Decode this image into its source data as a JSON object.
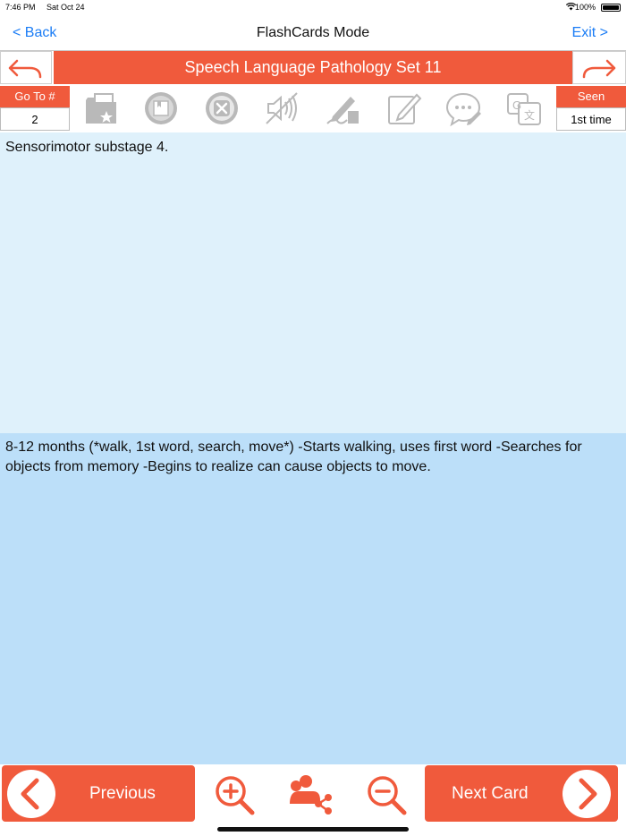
{
  "status_bar": {
    "time": "7:46 PM",
    "date": "Sat Oct 24",
    "battery": "100%"
  },
  "nav": {
    "back_label": "< Back",
    "title": "FlashCards Mode",
    "exit_label": "Exit >"
  },
  "set": {
    "title": "Speech Language Pathology Set 11"
  },
  "toolbar": {
    "goto_label": "Go To #",
    "goto_value": "2",
    "seen_label": "Seen",
    "seen_value": "1st time",
    "icons": [
      "folder-star-icon",
      "bookmark-icon",
      "delete-icon",
      "sound-off-icon",
      "handwriting-icon",
      "edit-note-icon",
      "comment-icon",
      "translate-icon"
    ]
  },
  "card": {
    "front": "Sensorimotor substage 4.",
    "back": "8-12 months (*walk, 1st word, search, move*) -Starts walking, uses first word -Searches for objects from memory -Begins to realize can cause objects to move."
  },
  "bottom": {
    "previous_label": "Previous",
    "next_label": "Next Card"
  },
  "colors": {
    "accent": "#f05a3c",
    "link": "#1a7cf5",
    "front_bg": "#dff1fb",
    "back_bg": "#bcdff9",
    "icon_gray": "#b9b9b9"
  }
}
